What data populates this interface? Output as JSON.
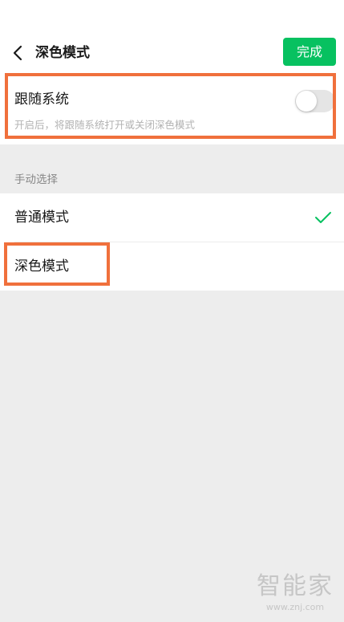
{
  "header": {
    "title": "深色模式",
    "done_label": "完成",
    "back_icon": "chevron-left-icon"
  },
  "follow_system": {
    "label": "跟随系统",
    "description": "开启后，将跟随系统打开或关闭深色模式",
    "enabled": false
  },
  "manual": {
    "section_header": "手动选择",
    "options": [
      {
        "label": "普通模式",
        "selected": true
      },
      {
        "label": "深色模式",
        "selected": false
      }
    ]
  },
  "watermark": {
    "logo_text": "智能家",
    "url": "www.znj.com"
  },
  "colors": {
    "accent": "#07c160",
    "highlight": "#f0703c",
    "background": "#ededed"
  }
}
